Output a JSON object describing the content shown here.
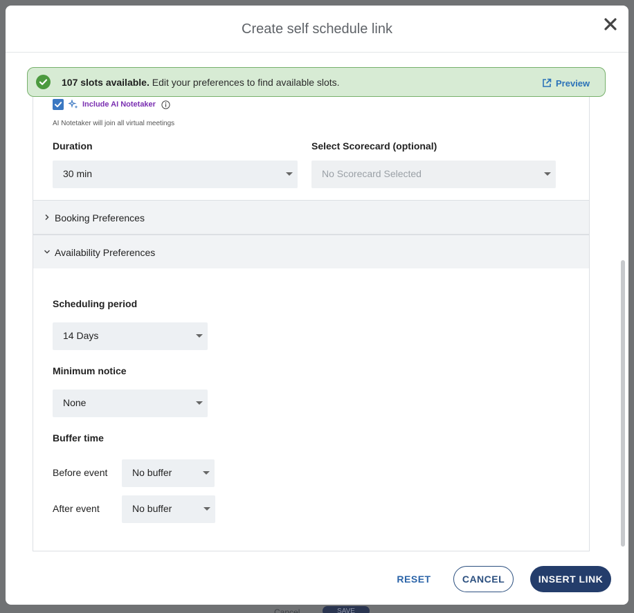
{
  "modal": {
    "title": "Create self schedule link"
  },
  "banner": {
    "slots_bold": "107 slots available.",
    "slots_rest": " Edit your preferences to find available slots.",
    "preview_label": "Preview"
  },
  "ai_notetaker": {
    "checked": true,
    "label": "Include AI Notetaker",
    "note": "AI Notetaker will join all virtual meetings"
  },
  "duration": {
    "label": "Duration",
    "value": "30 min"
  },
  "scorecard": {
    "label": "Select Scorecard (optional)",
    "placeholder": "No Scorecard Selected"
  },
  "sections": {
    "booking": "Booking Preferences",
    "availability": "Availability Preferences"
  },
  "availability": {
    "scheduling_period_label": "Scheduling period",
    "scheduling_period_value": "14 Days",
    "minimum_notice_label": "Minimum notice",
    "minimum_notice_value": "None",
    "buffer_time_label": "Buffer time",
    "before_event_label": "Before event",
    "before_event_value": "No buffer",
    "after_event_label": "After event",
    "after_event_value": "No buffer"
  },
  "footer": {
    "reset": "RESET",
    "cancel": "CANCEL",
    "insert": "INSERT LINK"
  },
  "backdrop": {
    "cancel": "Cancel",
    "save": "SAVE"
  },
  "colors": {
    "accent": "#243d6b",
    "success": "#4c9a3f",
    "banner_bg": "#d7ebd4",
    "ai_purple": "#7a2fb1"
  }
}
